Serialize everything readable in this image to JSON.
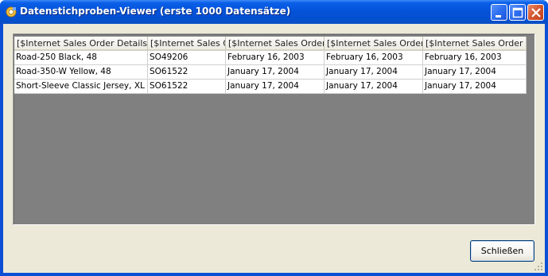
{
  "window": {
    "title": "Datenstichproben-Viewer (erste 1000 Datensätze)"
  },
  "grid": {
    "columns": [
      "[$Internet Sales Order Details].[",
      "[$Internet Sales O",
      "[$Internet Sales Order",
      "[$Internet Sales Order",
      "[$Internet Sales Order D"
    ],
    "rows": [
      [
        "Road-250 Black, 48",
        "SO49206",
        "February 16, 2003",
        "February 16, 2003",
        "February 16, 2003"
      ],
      [
        "Road-350-W Yellow, 48",
        "SO61522",
        "January 17, 2004",
        "January 17, 2004",
        "January 17, 2004"
      ],
      [
        "Short-Sleeve Classic Jersey, XL",
        "SO61522",
        "January 17, 2004",
        "January 17, 2004",
        "January 17, 2004"
      ]
    ]
  },
  "buttons": {
    "close_label": "Schließen"
  }
}
